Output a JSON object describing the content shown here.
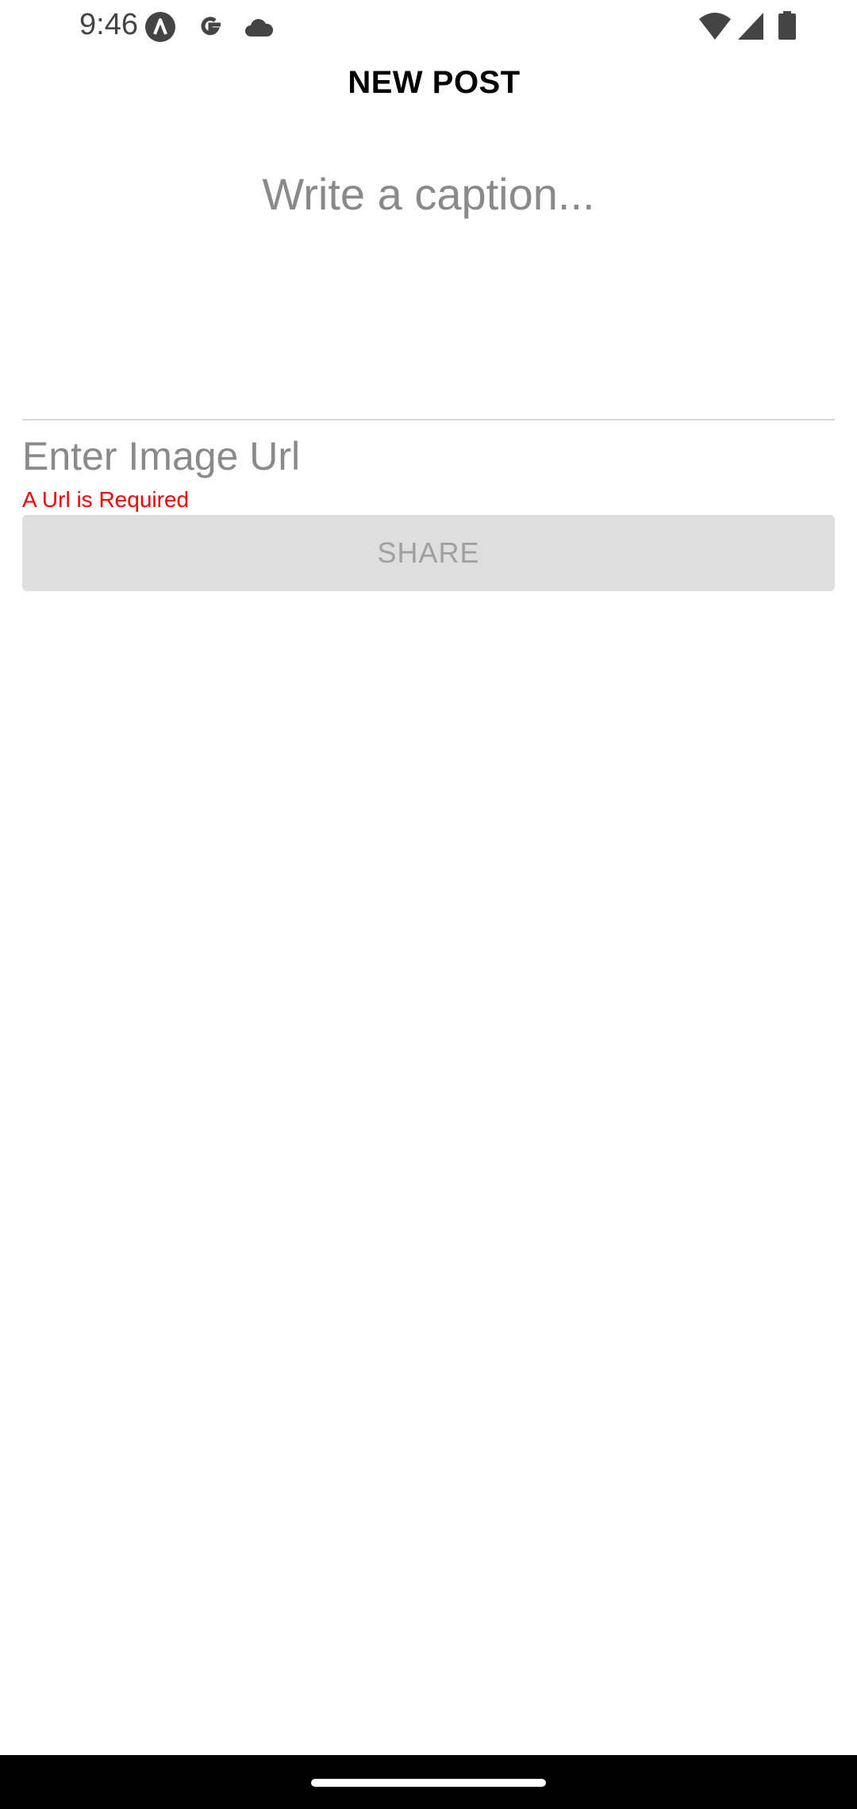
{
  "status_bar": {
    "time": "9:46",
    "left_icons": [
      "android-a-icon",
      "google-g-icon",
      "cloud-icon"
    ],
    "right_icons": [
      "wifi-icon",
      "cell-signal-icon",
      "battery-icon"
    ]
  },
  "header": {
    "title": "NEW POST"
  },
  "form": {
    "caption_placeholder": "Write a caption...",
    "caption_value": "",
    "url_placeholder": "Enter Image Url",
    "url_value": "",
    "url_error": "A Url is Required",
    "share_label": "SHARE"
  },
  "colors": {
    "error": "#ee0000",
    "button_disabled_bg": "#dedede",
    "button_disabled_text": "#a0a0a0",
    "placeholder": "#8a8a8a"
  }
}
